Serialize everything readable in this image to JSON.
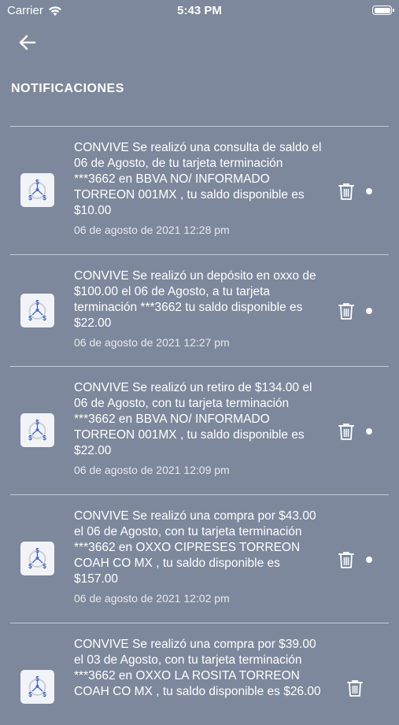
{
  "status": {
    "carrier": "Carrier",
    "time": "5:43 PM"
  },
  "header": {
    "title": "NOTIFICACIONES"
  },
  "notifications": [
    {
      "message": "CONVIVE Se realizó una consulta de saldo el 06 de Agosto, de tu tarjeta terminación ***3662  en BBVA NO/ INFORMADO TORREON 001MX , tu saldo disponible es $10.00",
      "date": "06 de agosto de 2021 12:28 pm",
      "unread": true
    },
    {
      "message": "CONVIVE Se realizó un depósito en oxxo de $100.00 el 06 de Agosto, a tu tarjeta terminación ***3662   tu saldo disponible es $22.00",
      "date": "06 de agosto de 2021 12:27 pm",
      "unread": true
    },
    {
      "message": "CONVIVE Se realizó un retiro de $134.00 el 06 de Agosto, con tu tarjeta terminación ***3662  en BBVA NO/ INFORMADO TORREON 001MX , tu saldo disponible es $22.00",
      "date": "06 de agosto de 2021 12:09 pm",
      "unread": true
    },
    {
      "message": "CONVIVE Se realizó una compra por $43.00 el 06 de Agosto, con tu tarjeta terminación ***3662  en OXXO CIPRESES TORREON COAH CO MX , tu saldo disponible es $157.00",
      "date": "06 de agosto de 2021 12:02 pm",
      "unread": true
    },
    {
      "message": "CONVIVE Se realizó una compra por $39.00 el 03 de Agosto, con tu tarjeta terminación ***3662  en OXXO LA ROSITA TORREON COAH CO MX , tu saldo disponible es $26.00",
      "date": "",
      "unread": false
    }
  ]
}
